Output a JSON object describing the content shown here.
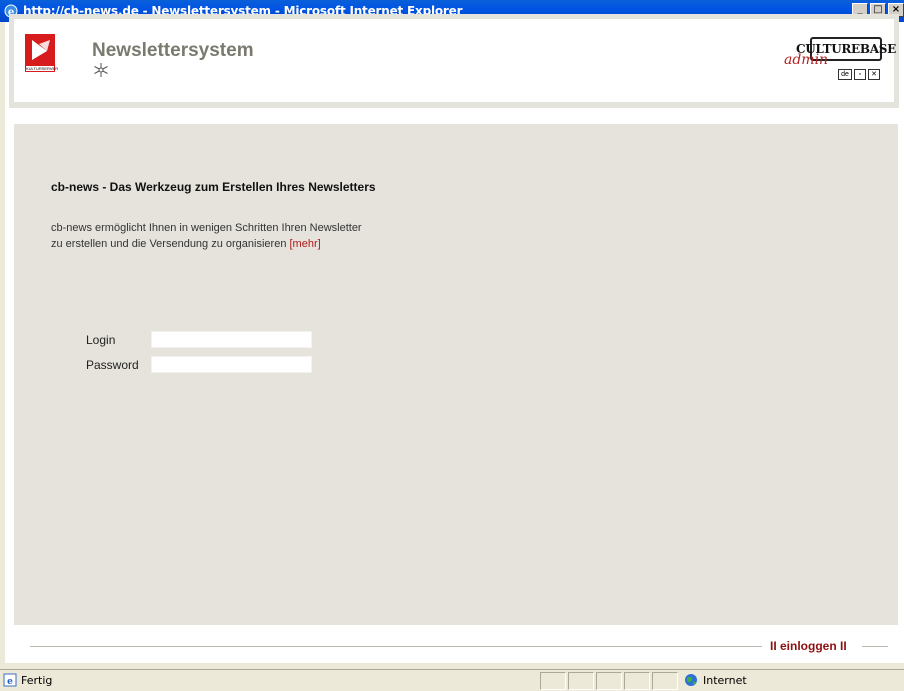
{
  "window": {
    "title": "http://cb-news.de - Newslettersystem - Microsoft Internet Explorer",
    "buttons": [
      "_",
      "□",
      "×"
    ]
  },
  "header": {
    "app_title": "Newslettersystem",
    "logo_text": "KULTURSERVER",
    "brand_name": "CULTUREBASE",
    "brand_sub": "admin",
    "lang_badge": "de"
  },
  "content": {
    "headline": "cb-news - Das Werkzeug zum Erstellen Ihres Newsletters",
    "intro_line1": "cb-news ermöglicht Ihnen in wenigen Schritten Ihren Newsletter",
    "intro_line2": "zu erstellen und die Versendung zu organisieren",
    "more_link": "[mehr]"
  },
  "form": {
    "login_label": "Login",
    "login_value": "",
    "password_label": "Password",
    "password_value": ""
  },
  "footer": {
    "login_link": "II  einloggen  II"
  },
  "statusbar": {
    "status_text": "Fertig",
    "zone_text": "Internet"
  },
  "colors": {
    "accent_red": "#b01818",
    "content_bg": "#e5e3dc",
    "title_bar": "#0054e3"
  }
}
